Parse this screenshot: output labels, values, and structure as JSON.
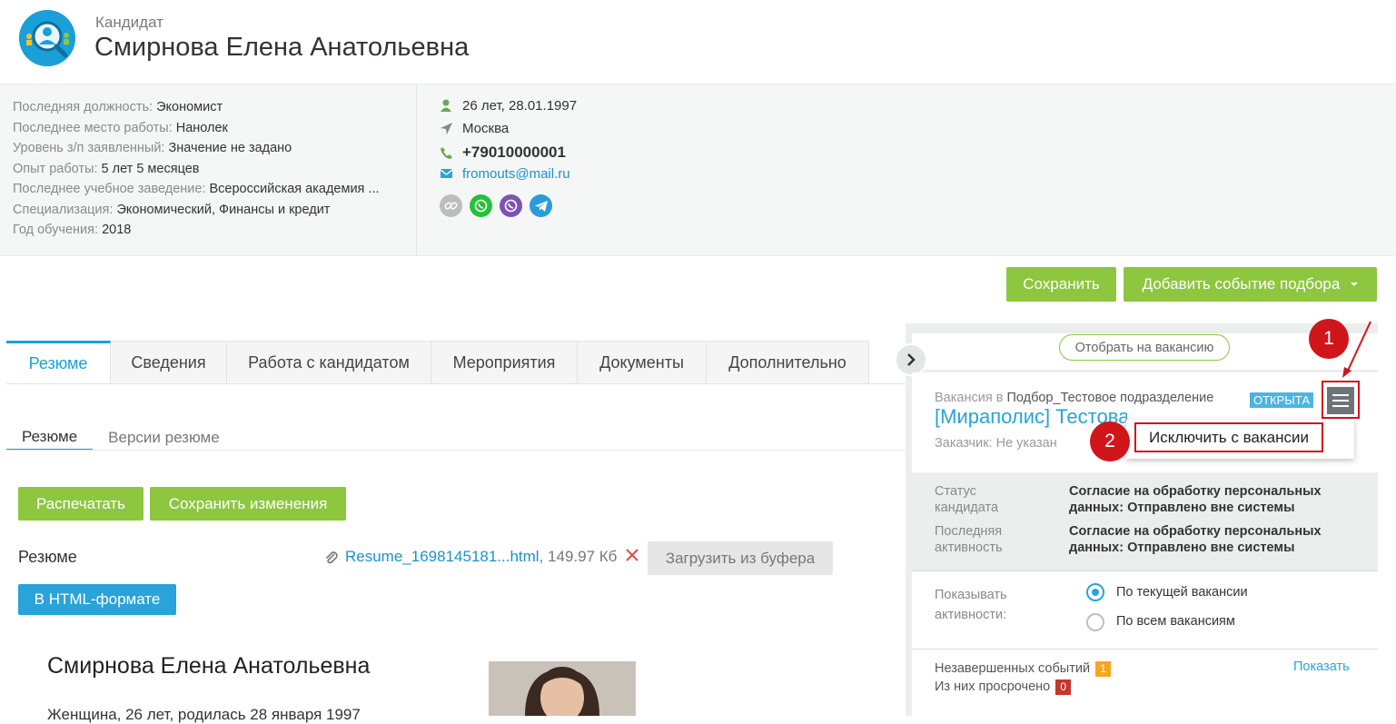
{
  "header": {
    "kind": "Кандидат",
    "name": "Смирнова Елена Анатольевна"
  },
  "info": [
    {
      "k": "Последняя должность:",
      "v": "Экономист"
    },
    {
      "k": "Последнее место работы:",
      "v": "Нанолек"
    },
    {
      "k": "Уровень з/п заявленный:",
      "v": "Значение не задано"
    },
    {
      "k": "Опыт работы:",
      "v": "5 лет 5 месяцев"
    },
    {
      "k": "Последнее учебное заведение:",
      "v": "Всероссийская академия ..."
    },
    {
      "k": "Специализация:",
      "v": "Экономический, Финансы и кредит"
    },
    {
      "k": "Год обучения:",
      "v": "2018"
    }
  ],
  "contacts": {
    "birth": "26 лет, 28.01.1997",
    "city": "Москва",
    "phone": "+79010000001",
    "email": "fromouts@mail.ru"
  },
  "actions": {
    "save": "Сохранить",
    "add_event": "Добавить событие подбора"
  },
  "tabs": [
    {
      "label": "Резюме"
    },
    {
      "label": "Сведения"
    },
    {
      "label": "Работа с кандидатом"
    },
    {
      "label": "Мероприятия"
    },
    {
      "label": "Документы"
    },
    {
      "label": "Дополнительно"
    }
  ],
  "subtabs": [
    {
      "label": "Резюме"
    },
    {
      "label": "Версии резюме"
    }
  ],
  "resume": {
    "print": "Распечатать",
    "save_changes": "Сохранить изменения",
    "label": "Резюме",
    "file_name": "Resume_1698145181...html",
    "file_size": ", 149.97 Кб",
    "load_buffer": "Загрузить из буфера",
    "html_format": "В HTML-формате",
    "doc_name": "Смирнова Елена Анатольевна",
    "doc_line": "Женщина, 26 лет, родилась 28 января 1997"
  },
  "panel": {
    "select_vacancy": "Отобрать на вакансию",
    "vacancy_in": "Вакансия в",
    "department": "Подбор_Тестовое подразделение",
    "status_badge": "ОТКРЫТА",
    "vacancy_title": "[Мираполис] Тестовая",
    "customer": "Заказчик: Не указан",
    "dropdown_item": "Исключить с вакансии",
    "callout_1": "1",
    "callout_2": "2",
    "status_label_1": "Статус",
    "status_label_2": "кандидата",
    "status_value": "Согласие на обработку персональных данных: Отправлено вне системы",
    "activity_label_1": "Последняя",
    "activity_label_2": "активность",
    "activity_value": "Согласие на обработку персональных данных: Отправлено вне системы",
    "show_label_1": "Показывать",
    "show_label_2": "активности:",
    "radio_current": "По текущей вакансии",
    "radio_all": "По всем вакансиям",
    "unfinished_label": "Незавершенных событий",
    "unfinished_count": "1",
    "overdue_label": "Из них просрочено",
    "overdue_count": "0",
    "show_link": "Показать"
  },
  "colors": {
    "accent": "#1aa0d8",
    "green": "#8dc63f",
    "red": "#d0151b"
  }
}
